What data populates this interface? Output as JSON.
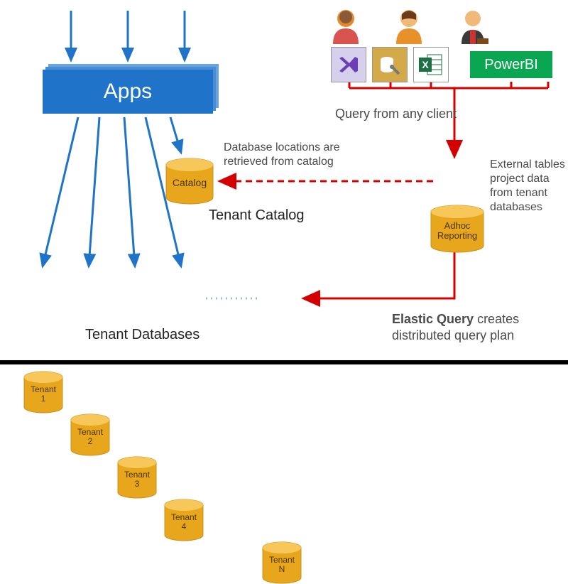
{
  "apps": {
    "label": "Apps"
  },
  "catalog": {
    "label": "Catalog"
  },
  "adhoc": {
    "label": "Adhoc\nReporting"
  },
  "tenants": {
    "items": [
      {
        "name": "Tenant",
        "num": "1"
      },
      {
        "name": "Tenant",
        "num": "2"
      },
      {
        "name": "Tenant",
        "num": "3"
      },
      {
        "name": "Tenant",
        "num": "4"
      },
      {
        "name": "Tenant",
        "num": "N"
      }
    ]
  },
  "powerbi": {
    "label": "PowerBI"
  },
  "captions": {
    "query_from_client": "Query from any client",
    "db_locations": "Database locations are retrieved from catalog",
    "tenant_catalog": "Tenant Catalog",
    "external_tables": "External tables project data from tenant databases",
    "elastic_bold": "Elastic Query",
    "elastic_rest": " creates distributed query plan",
    "tenant_databases": "Tenant Databases"
  },
  "icons": {
    "user1": "user-orange",
    "user2": "user-orange",
    "user3": "business-user",
    "vs": "visual-studio",
    "tool": "db-tool",
    "excel": "excel"
  }
}
